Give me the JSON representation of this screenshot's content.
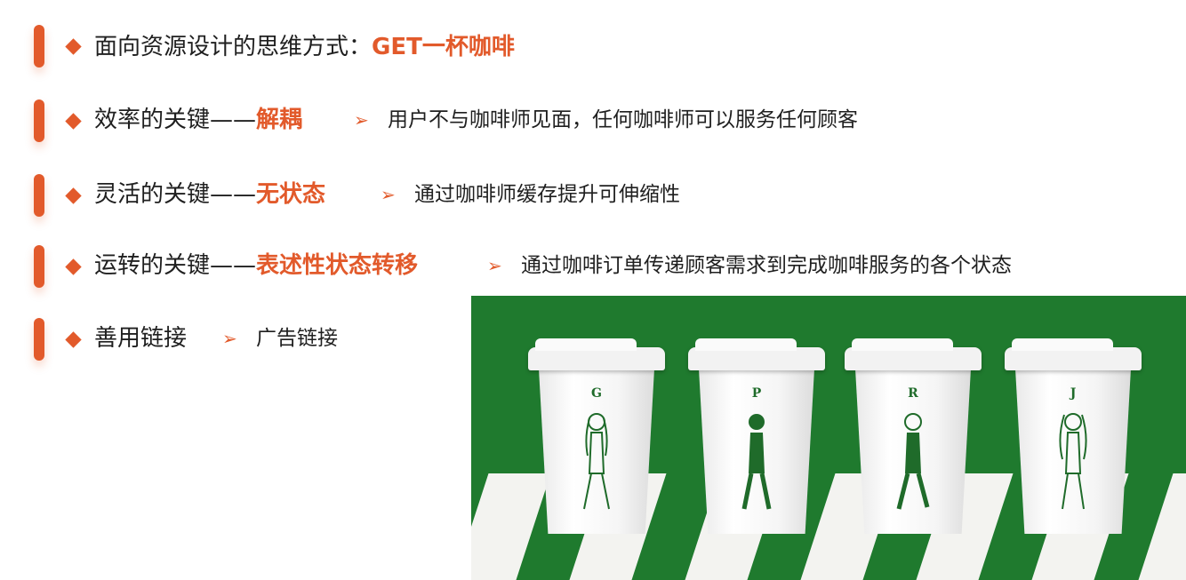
{
  "rows": [
    {
      "main": "面向资源设计的思维方式：",
      "highlight": "GET一杯咖啡",
      "arrow": "",
      "sub": ""
    },
    {
      "main": "效率的关键——",
      "highlight": "解耦",
      "arrow": "➢",
      "sub": "用户不与咖啡师见面，任何咖啡师可以服务任何顾客"
    },
    {
      "main": "灵活的关键——",
      "highlight": "无状态",
      "arrow": "➢",
      "sub": "通过咖啡师缓存提升可伸缩性"
    },
    {
      "main": "运转的关键——",
      "highlight": "表述性状态转移",
      "arrow": "➢",
      "sub": "通过咖啡订单传递顾客需求到完成咖啡服务的各个状态"
    },
    {
      "main": "善用链接",
      "highlight": "",
      "arrow": "➢",
      "sub": "广告链接"
    }
  ],
  "photo": {
    "cup_letters": [
      "G",
      "P",
      "R",
      "J"
    ],
    "background_color": "#1f7a2e"
  },
  "colors": {
    "accent": "#e25a2b",
    "text": "#1f1f1f"
  }
}
